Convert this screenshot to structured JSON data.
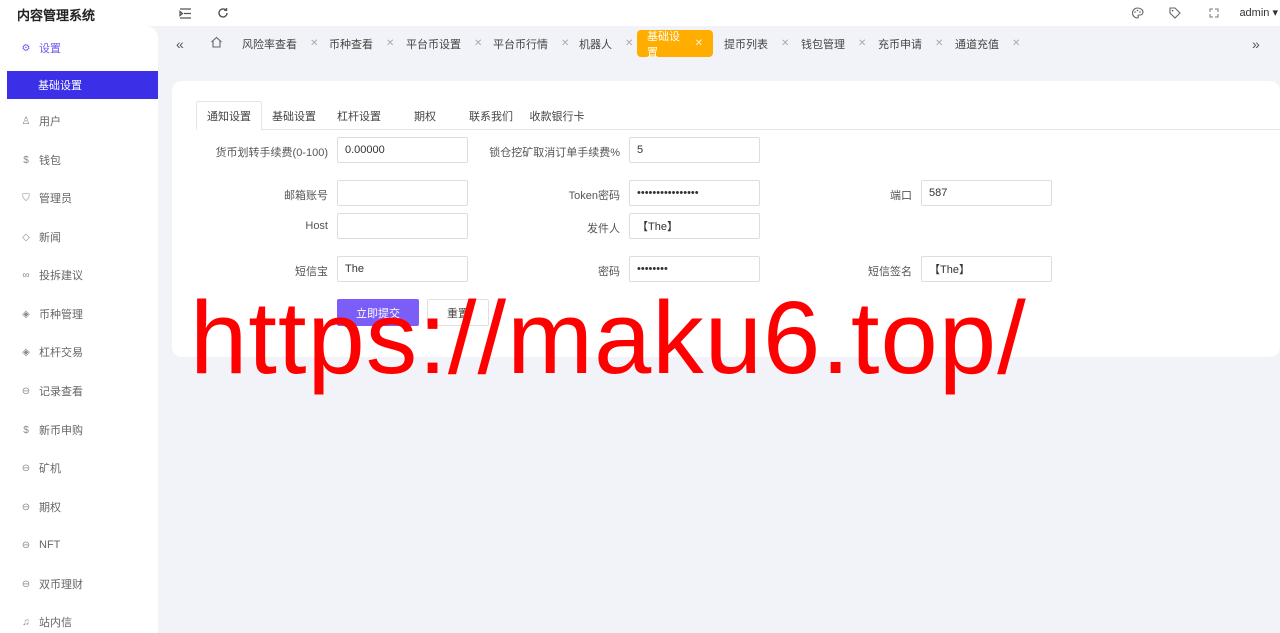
{
  "app": {
    "title": "内容管理系统",
    "user": "admin"
  },
  "header": {
    "icons": [
      "menu-fold-icon",
      "refresh-icon",
      "palette-icon",
      "tag-icon",
      "fullscreen-icon"
    ]
  },
  "sidebar": {
    "items": [
      {
        "label": "设置",
        "icon": "gear-icon",
        "active": true
      },
      {
        "label": "用户",
        "icon": "user-icon"
      },
      {
        "label": "钱包",
        "icon": "dollar-icon"
      },
      {
        "label": "管理员",
        "icon": "shield-icon"
      },
      {
        "label": "新闻",
        "icon": "tag-icon"
      },
      {
        "label": "投拆建议",
        "icon": "link-icon"
      },
      {
        "label": "币种管理",
        "icon": "diamond-icon"
      },
      {
        "label": "杠杆交易",
        "icon": "diamond-icon"
      },
      {
        "label": "记录查看",
        "icon": "circle-icon"
      },
      {
        "label": "新币申购",
        "icon": "dollar-icon"
      },
      {
        "label": "矿机",
        "icon": "circle-icon"
      },
      {
        "label": "期权",
        "icon": "circle-icon"
      },
      {
        "label": "NFT",
        "icon": "circle-icon"
      },
      {
        "label": "双币理财",
        "icon": "circle-icon"
      },
      {
        "label": "站内信",
        "icon": "bell-icon"
      }
    ],
    "subitem": {
      "label": "基础设置"
    }
  },
  "tabs": [
    {
      "label": "风险率查看"
    },
    {
      "label": "币种查看"
    },
    {
      "label": "平台币设置"
    },
    {
      "label": "平台币行情"
    },
    {
      "label": "机器人"
    },
    {
      "label": "基础设置",
      "active": true
    },
    {
      "label": "提币列表"
    },
    {
      "label": "钱包管理"
    },
    {
      "label": "充币申请"
    },
    {
      "label": "通道充值"
    }
  ],
  "settings_tabs": [
    {
      "label": "通知设置",
      "active": true
    },
    {
      "label": "基础设置"
    },
    {
      "label": "杠杆设置"
    },
    {
      "label": "期权"
    },
    {
      "label": "联系我们"
    },
    {
      "label": "收款银行卡"
    }
  ],
  "form": {
    "fee_label": "货币划转手续费(0-100)",
    "fee_value": "0.00000",
    "lock_fee_label": "锁仓挖矿取消订单手续费%",
    "lock_fee_value": "5",
    "email_label": "邮箱账号",
    "email_value": "",
    "token_label": "Token密码",
    "token_value": "••••••••••••••••",
    "port_label": "端口",
    "port_value": "587",
    "host_label": "Host",
    "host_value": "",
    "sender_label": "发件人",
    "sender_value": "【The】",
    "sms_label": "短信宝",
    "sms_value": "The",
    "pwd_label": "密码",
    "pwd_value": "••••••••",
    "sign_label": "短信签名",
    "sign_value": "【The】",
    "submit_label": "立即提交",
    "reset_label": "重置"
  },
  "watermark": "https://maku6.top/",
  "colors": {
    "accent": "#3b2fe8",
    "tab_active": "#ffae00",
    "submit": "#7b5ef8",
    "watermark": "#ff0000"
  }
}
